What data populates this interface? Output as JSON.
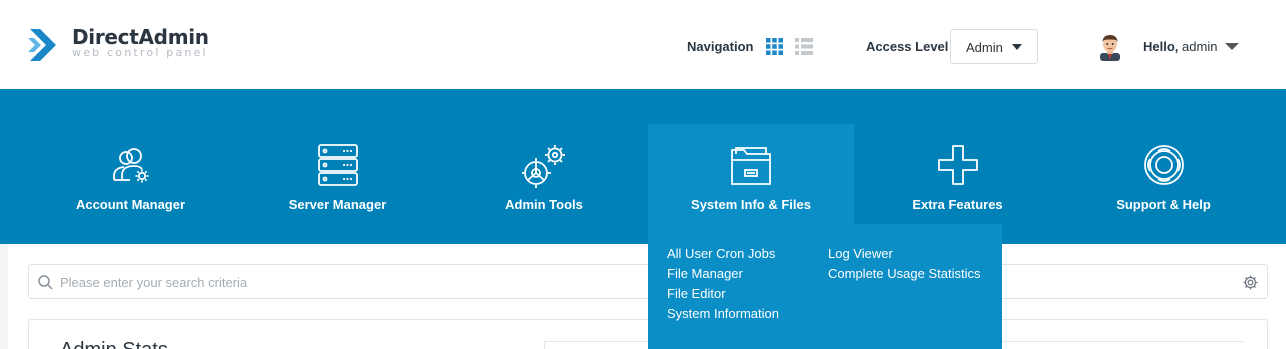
{
  "logo": {
    "title": "DirectAdmin",
    "subtitle": "web control panel"
  },
  "header": {
    "navigation_label": "Navigation",
    "access_level_label": "Access Level",
    "access_level_value": "Admin",
    "hello_prefix": "Hello,",
    "username": "admin"
  },
  "menu": [
    {
      "label": "Account Manager",
      "icon": "account-manager-icon"
    },
    {
      "label": "Server Manager",
      "icon": "server-icon"
    },
    {
      "label": "Admin Tools",
      "icon": "gears-icon"
    },
    {
      "label": "System Info & Files",
      "icon": "folder-icon",
      "active": true
    },
    {
      "label": "Extra Features",
      "icon": "plus-icon"
    },
    {
      "label": "Support & Help",
      "icon": "lifebuoy-icon"
    }
  ],
  "dropdown": {
    "col1": [
      "All User Cron Jobs",
      "File Manager",
      "File Editor",
      "System Information"
    ],
    "col2": [
      "Log Viewer",
      "Complete Usage Statistics"
    ]
  },
  "search": {
    "placeholder": "Please enter your search criteria"
  },
  "stats": {
    "title": "Admin Stats"
  },
  "colors": {
    "band": "#0082b9",
    "active": "#0a8ec5",
    "accent": "#1a87c8"
  }
}
